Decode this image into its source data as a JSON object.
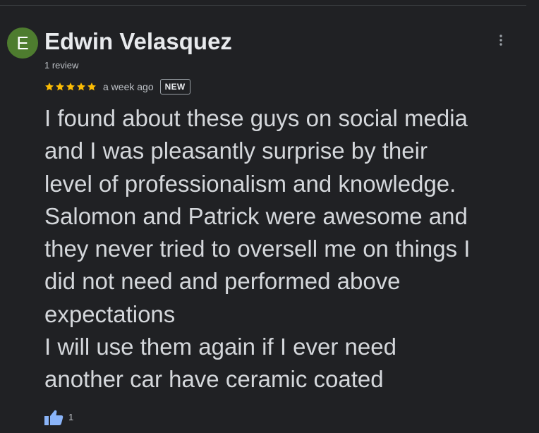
{
  "reviewer": {
    "avatar_initial": "E",
    "avatar_color": "#4e7c2f",
    "name": "Edwin Velasquez",
    "review_count": "1 review"
  },
  "review": {
    "rating": 5,
    "max_rating": 5,
    "star_color": "#fbbc04",
    "time_ago": "a week ago",
    "badge": "NEW",
    "text_lines": [
      "I found about these guys on social media",
      "and I was pleasantly surprise by their",
      "level of professionalism and knowledge.",
      "Salomon and Patrick were awesome and",
      "they never tried to oversell me on things I",
      "did not need and performed above",
      "expectations",
      "I will use them again if I ever need",
      "another car have ceramic coated"
    ]
  },
  "actions": {
    "like_icon": "thumbs-up-icon",
    "like_count": "1",
    "like_color": "#8ab4f8",
    "more_icon": "more-vert-icon"
  },
  "theme": {
    "background": "#202124",
    "text_primary": "#e8eaed",
    "text_secondary": "#bdc1c6"
  }
}
